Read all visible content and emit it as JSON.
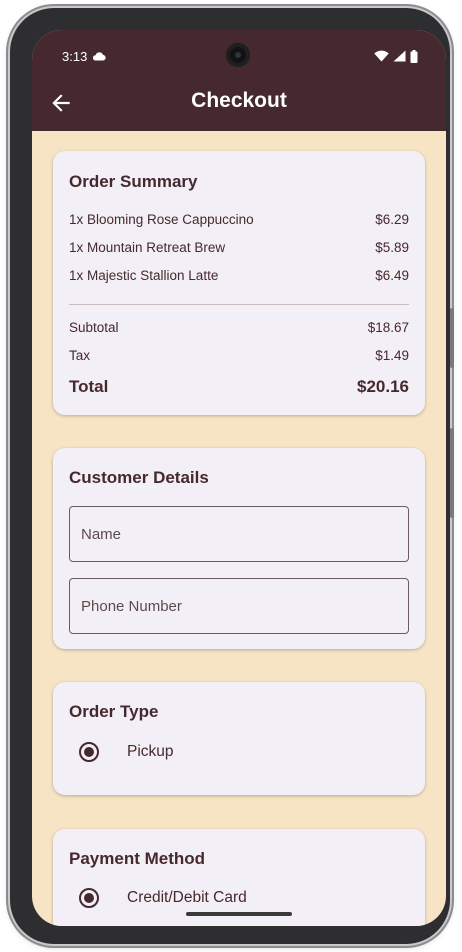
{
  "status_bar": {
    "time": "3:13",
    "icons": [
      "cloud-icon",
      "wifi-icon",
      "signal-icon",
      "battery-icon"
    ]
  },
  "app_bar": {
    "title": "Checkout",
    "back_icon": "arrow-left-icon"
  },
  "order_summary": {
    "heading": "Order Summary",
    "items": [
      {
        "label": "1x Blooming Rose Cappuccino",
        "price": "$6.29"
      },
      {
        "label": "1x Mountain Retreat Brew",
        "price": "$5.89"
      },
      {
        "label": "1x Majestic Stallion Latte",
        "price": "$6.49"
      }
    ],
    "subtotal_label": "Subtotal",
    "subtotal_value": "$18.67",
    "tax_label": "Tax",
    "tax_value": "$1.49",
    "total_label": "Total",
    "total_value": "$20.16"
  },
  "customer_details": {
    "heading": "Customer Details",
    "name_placeholder": "Name",
    "name_value": "",
    "phone_placeholder": "Phone Number",
    "phone_value": ""
  },
  "order_type": {
    "heading": "Order Type",
    "options": [
      {
        "label": "Pickup",
        "selected": true
      }
    ]
  },
  "payment_method": {
    "heading": "Payment Method",
    "options": [
      {
        "label": "Credit/Debit Card",
        "selected": true
      }
    ]
  },
  "colors": {
    "app_bar": "#45292e",
    "background": "#f7e4c4",
    "card": "#f3eff6",
    "text": "#45292e"
  }
}
